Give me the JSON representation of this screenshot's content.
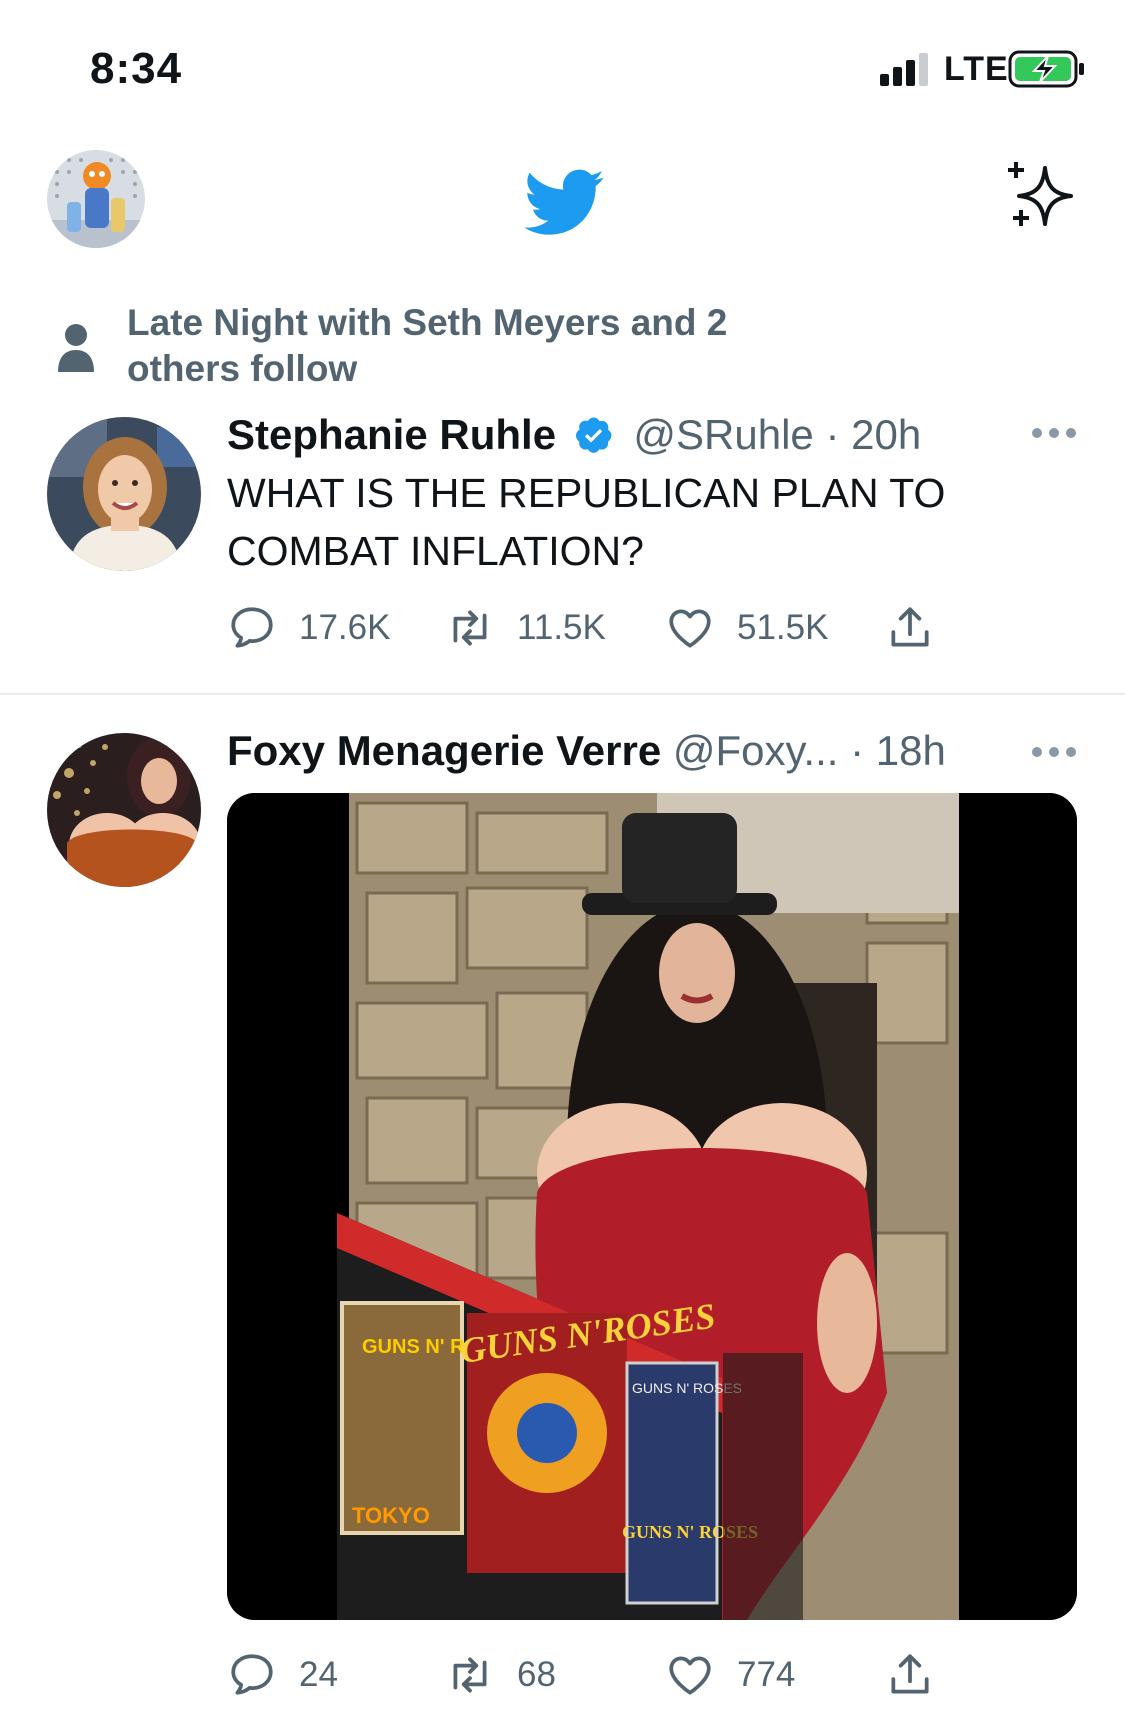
{
  "status_bar": {
    "time": "8:34",
    "network": "LTE"
  },
  "header": {
    "logo": "twitter-bird-icon",
    "sparkle": "sparkle-icon",
    "accent": "#1d9bf0"
  },
  "social_context": {
    "text": "Late Night with Seth Meyers and 2 others follow"
  },
  "tweets": [
    {
      "name": "Stephanie Ruhle",
      "verified": true,
      "handle": "@SRuhle",
      "time": "· 20h",
      "text": "WHAT IS THE REPUBLICAN PLAN TO COMBAT INFLATION?",
      "replies": "17.6K",
      "retweets": "11.5K",
      "likes": "51.5K"
    },
    {
      "name": "Foxy Menagerie Verre",
      "verified": false,
      "handle": "@Foxy...",
      "time": "· 18h",
      "replies": "24",
      "retweets": "68",
      "likes": "774"
    }
  ],
  "media_text": {
    "poster_top": "GUNS N' ROSES",
    "logo": "GUNS N'ROSES",
    "poster_bottom": "TOKYO",
    "panel_top": "GUNS N' ROSES",
    "panel_bottom": "GUNS N' ROSES"
  }
}
